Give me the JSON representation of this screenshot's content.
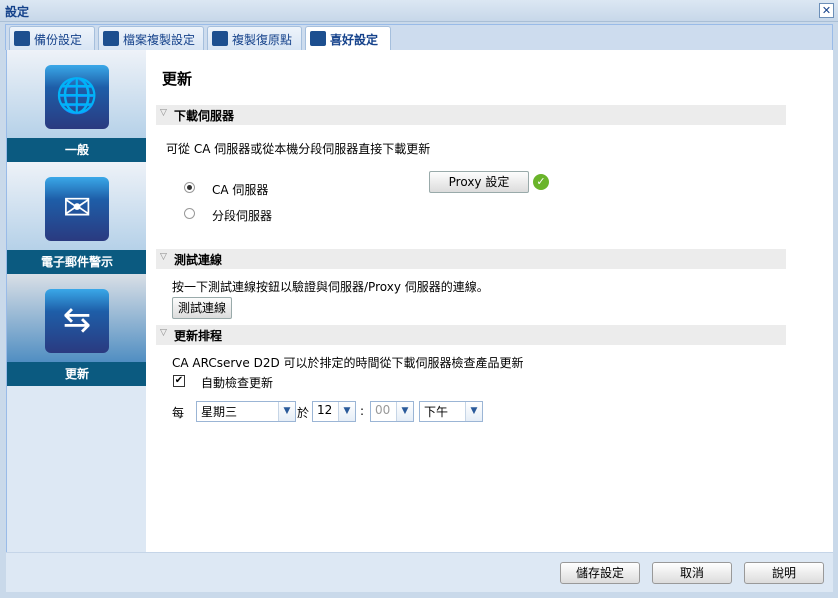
{
  "window": {
    "title": "設定",
    "close_icon": "close-icon"
  },
  "tabs": [
    {
      "label": "備份設定"
    },
    {
      "label": "檔案複製設定"
    },
    {
      "label": "複製復原點"
    },
    {
      "label": "喜好設定"
    }
  ],
  "sidebar": {
    "items": [
      {
        "label": "一般",
        "icon": "globe-icon"
      },
      {
        "label": "電子郵件警示",
        "icon": "email-alert-icon"
      },
      {
        "label": "更新",
        "icon": "arrows-icon"
      }
    ]
  },
  "main": {
    "title": "更新",
    "download_server": {
      "header": "下載伺服器",
      "description": "可從 CA 伺服器或從本機分段伺服器直接下載更新",
      "options": [
        "CA 伺服器",
        "分段伺服器"
      ],
      "selected": "CA 伺服器",
      "proxy_button": "Proxy 設定"
    },
    "test_connection": {
      "header": "測試連線",
      "description": "按一下測試連線按鈕以驗證與伺服器/Proxy 伺服器的連線。",
      "button": "測試連線"
    },
    "schedule": {
      "header": "更新排程",
      "description": "CA ARCserve D2D 可以於排定的時間從下載伺服器檢查產品更新",
      "auto_check_label": "自動檢查更新",
      "auto_check": true,
      "every_label": "每",
      "day": "星期三",
      "at_label": "於",
      "hour": "12",
      "colon": ":",
      "minute": "00",
      "ampm": "下午"
    }
  },
  "footer": {
    "save": "儲存設定",
    "cancel": "取消",
    "help": "說明"
  }
}
